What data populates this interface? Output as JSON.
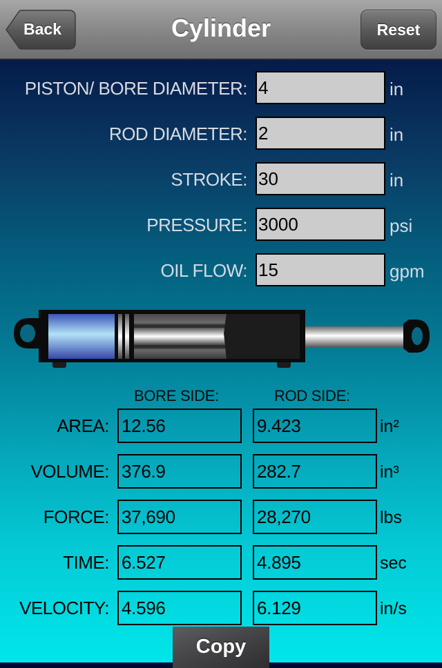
{
  "navbar": {
    "title": "Cylinder",
    "back_label": "Back",
    "reset_label": "Reset"
  },
  "inputs": [
    {
      "label": "PISTON/ BORE DIAMETER:",
      "value": "4",
      "unit": "in"
    },
    {
      "label": "ROD DIAMETER:",
      "value": "2",
      "unit": "in"
    },
    {
      "label": "STROKE:",
      "value": "30",
      "unit": "in"
    },
    {
      "label": "PRESSURE:",
      "value": "3000",
      "unit": "psi"
    },
    {
      "label": "OIL FLOW:",
      "value": "15",
      "unit": "gpm"
    }
  ],
  "illustration": {
    "name": "hydraulic-cylinder-diagram",
    "colors": {
      "bore_chamber": "#6f8fe0",
      "body": "#111111",
      "rod": "#d8d8d8"
    }
  },
  "results": {
    "column_headers": {
      "bore": "BORE SIDE:",
      "rod": "ROD SIDE:"
    },
    "rows": [
      {
        "label": "AREA:",
        "bore": "12.56",
        "rod": "9.423",
        "unit": "in²"
      },
      {
        "label": "VOLUME:",
        "bore": "376.9",
        "rod": "282.7",
        "unit": "in³"
      },
      {
        "label": "FORCE:",
        "bore": "37,690",
        "rod": "28,270",
        "unit": "lbs"
      },
      {
        "label": "TIME:",
        "bore": "6.527",
        "rod": "4.895",
        "unit": "sec"
      },
      {
        "label": "VELOCITY:",
        "bore": "4.596",
        "rod": "6.129",
        "unit": "in/s"
      }
    ]
  },
  "footer": {
    "copy_label": "Copy"
  }
}
